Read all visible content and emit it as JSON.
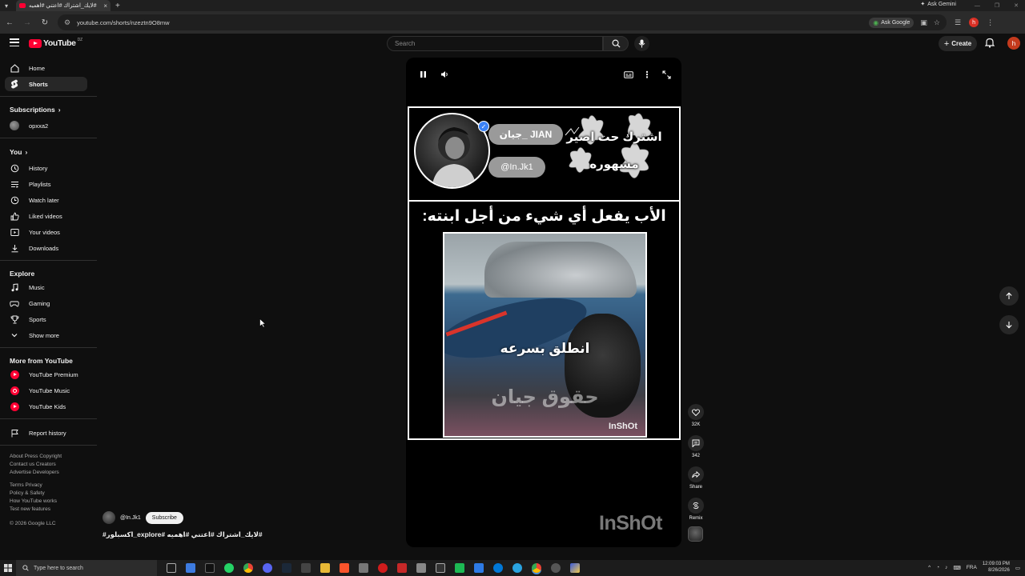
{
  "browser": {
    "tab_title": "#لايك_اشتراك #اعتني #اهميه",
    "ask_gemini": "Ask Gemini",
    "url": "youtube.com/shorts/nzeztn9O8mw",
    "ask_google": "Ask Google",
    "profile_initial": "h"
  },
  "masthead": {
    "logo_text": "YouTube",
    "country_code": "DZ",
    "search_placeholder": "Search",
    "create_label": "Create",
    "avatar_initial": "h"
  },
  "sidebar": {
    "main": [
      {
        "label": "Home",
        "icon": "home-icon"
      },
      {
        "label": "Shorts",
        "icon": "shorts-icon",
        "active": true
      }
    ],
    "subscriptions_heading": "Subscriptions",
    "subscriptions": [
      {
        "label": "opxxa2"
      }
    ],
    "you_heading": "You",
    "you": [
      {
        "label": "History",
        "icon": "history-icon"
      },
      {
        "label": "Playlists",
        "icon": "playlists-icon"
      },
      {
        "label": "Watch later",
        "icon": "watch-later-icon"
      },
      {
        "label": "Liked videos",
        "icon": "like-icon"
      },
      {
        "label": "Your videos",
        "icon": "your-videos-icon"
      },
      {
        "label": "Downloads",
        "icon": "download-icon"
      }
    ],
    "explore_heading": "Explore",
    "explore": [
      {
        "label": "Music",
        "icon": "music-icon"
      },
      {
        "label": "Gaming",
        "icon": "gaming-icon"
      },
      {
        "label": "Sports",
        "icon": "trophy-icon"
      },
      {
        "label": "Show more",
        "icon": "chevron-down-icon"
      }
    ],
    "more_heading": "More from YouTube",
    "more": [
      {
        "label": "YouTube Premium"
      },
      {
        "label": "YouTube Music"
      },
      {
        "label": "YouTube Kids"
      }
    ],
    "report_history": "Report history",
    "footer_line1": "About  Press  Copyright",
    "footer_line2": "Contact us  Creators",
    "footer_line3": "Advertise  Developers",
    "footer_line4": "Terms  Privacy",
    "footer_line5": "Policy & Safety",
    "footer_line6": "How YouTube works",
    "footer_line7": "Test new features",
    "copyright": "© 2026 Google LLC"
  },
  "video": {
    "name_pill": "جيان_ JIAN",
    "handle_pill": "@In.Jk1",
    "promo_line1": "اشترك حت اصير",
    "promo_line2": "مشهوره",
    "headline": "الأب يفعل أي شيء من أجل ابنته:",
    "clip_caption": "انطلق بسرعه",
    "clip_watermark": "حقوق جيان",
    "clip_inshot": "InShOt",
    "big_inshot": "InShOt"
  },
  "actions": {
    "likes": "32K",
    "comments": "342",
    "share": "Share",
    "remix": "Remix"
  },
  "channel": {
    "handle": "@In.Jk1",
    "subscribe": "Subscribe",
    "hashtags": "#لايك_اشتراك #اعتني #اهميه #explore_اكسبلور#"
  },
  "taskbar": {
    "search_placeholder": "Type here to search",
    "lang": "FRA",
    "time": "12:09:03 PM",
    "date": "8/26/2026"
  }
}
